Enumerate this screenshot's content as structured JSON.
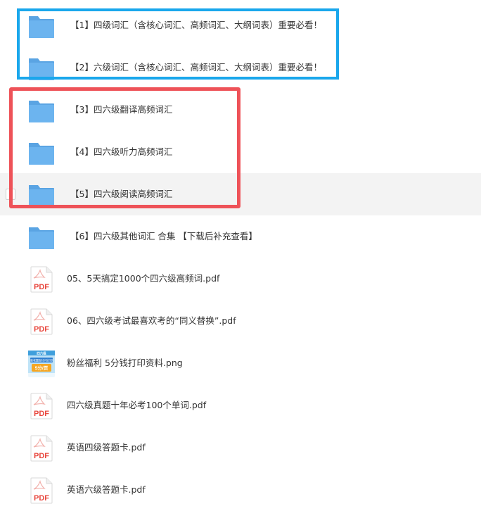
{
  "files": [
    {
      "type": "folder",
      "name": "【1】四级词汇（含核心词汇、高频词汇、大纲词表）重要必看！"
    },
    {
      "type": "folder",
      "name": "【2】六级词汇（含核心词汇、高频词汇、大纲词表）重要必看！"
    },
    {
      "type": "folder",
      "name": "【3】四六级翻译高频词汇"
    },
    {
      "type": "folder",
      "name": "【4】四六级听力高频词汇"
    },
    {
      "type": "folder",
      "name": "【5】四六级阅读高频词汇",
      "hovered": true
    },
    {
      "type": "folder",
      "name": "【6】四六级其他词汇 合集 【下载后补充查看】"
    },
    {
      "type": "pdf",
      "name": "05、5天搞定1000个四六级高频词.pdf"
    },
    {
      "type": "pdf",
      "name": "06、四六级考试最喜欢考的“同义替换”.pdf"
    },
    {
      "type": "image",
      "name": "粉丝福利 5分钱打印资料.png"
    },
    {
      "type": "pdf",
      "name": "四六级真题十年必考100个单词.pdf"
    },
    {
      "type": "pdf",
      "name": "英语四级答题卡.pdf"
    },
    {
      "type": "pdf",
      "name": "英语六级答题卡.pdf"
    }
  ],
  "pdf_badge": "PDF",
  "thumbnail_text": {
    "top": "四六级",
    "middle": "新老题型均可打印",
    "bottom": "5分/页"
  },
  "colors": {
    "folder": "#6cb4ef",
    "folder_tab": "#5aa4e3",
    "pdf_red": "#e8483f",
    "highlight_blue": "#1aa7ec",
    "highlight_red": "#ee5258",
    "hover_bg": "#f3f3f3",
    "text": "#333333"
  }
}
